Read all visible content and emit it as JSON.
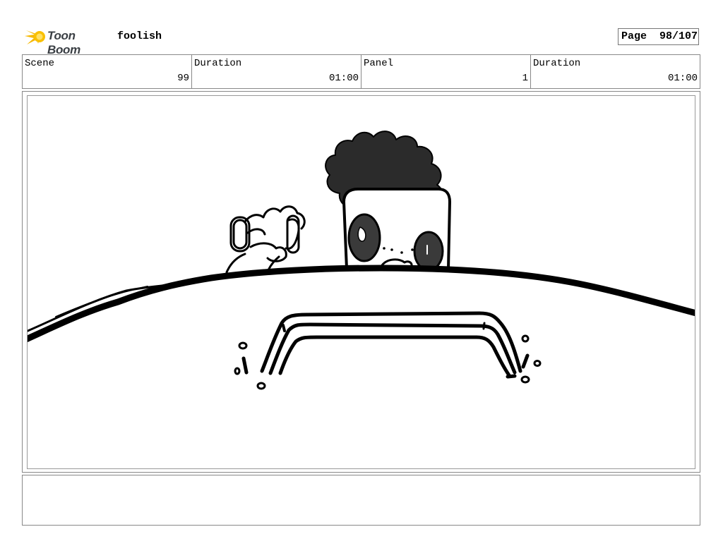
{
  "header": {
    "brand": "Toon Boom",
    "project": "foolish",
    "page_label": "Page",
    "page_value": "98/107"
  },
  "info": {
    "scene_label": "Scene",
    "scene_value": "99",
    "scene_duration_label": "Duration",
    "scene_duration_value": "01:00",
    "panel_label": "Panel",
    "panel_value": "1",
    "panel_duration_label": "Duration",
    "panel_duration_value": "01:00"
  },
  "notes": {
    "text": ""
  }
}
